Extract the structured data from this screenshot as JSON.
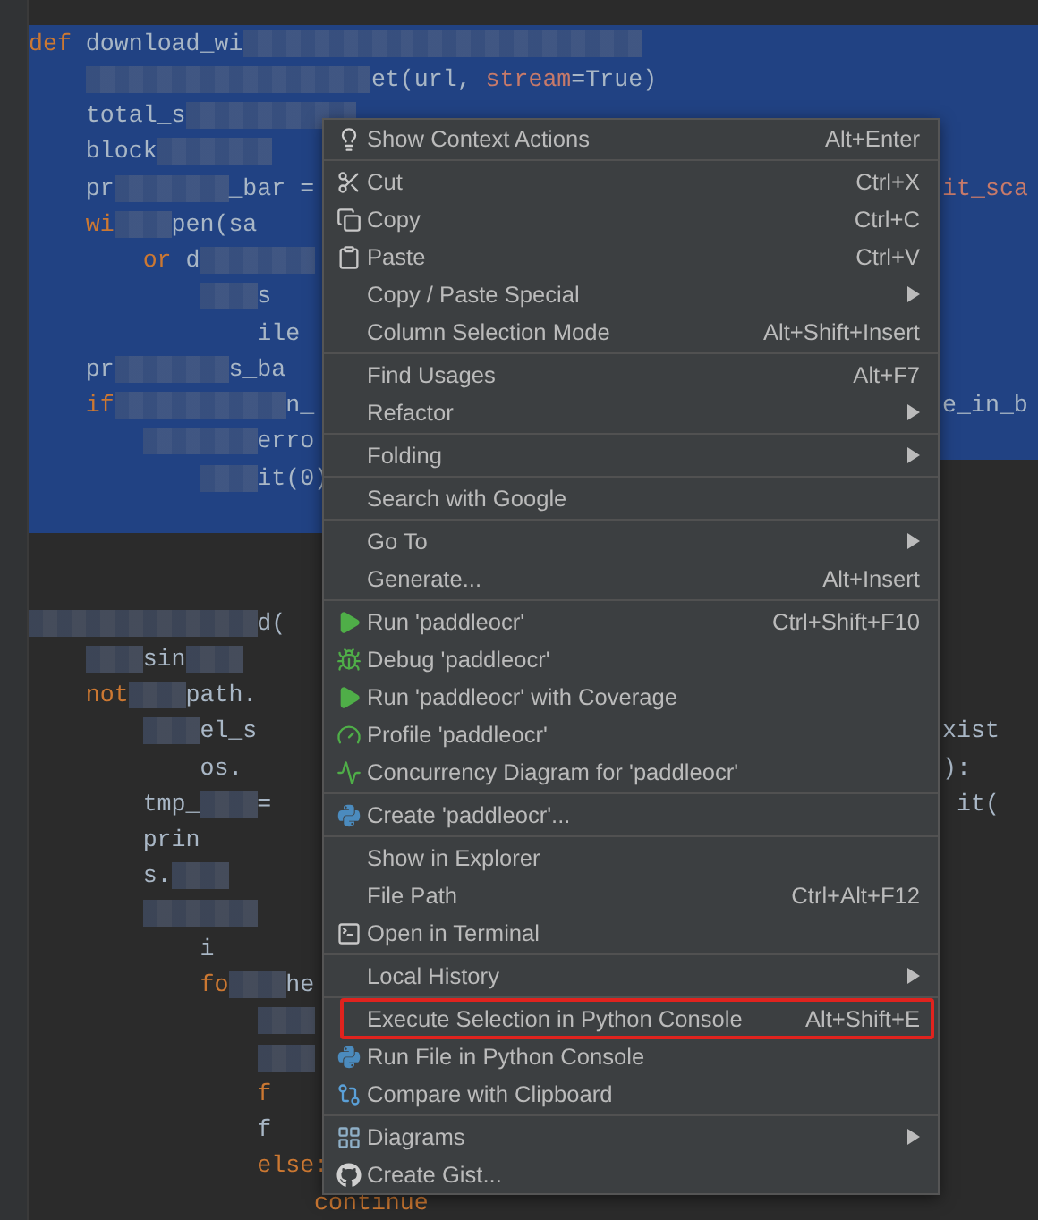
{
  "editor": {
    "lines": [
      {
        "selected": true,
        "full_width": true,
        "segments": [
          {
            "kind": "kw",
            "text": "def"
          },
          {
            "kind": "plain",
            "text": " download_wi"
          },
          {
            "kind": "redacted"
          },
          {
            "kind": "redacted"
          },
          {
            "kind": "redacted"
          },
          {
            "kind": "redacted"
          },
          {
            "kind": "redacted"
          },
          {
            "kind": "redacted"
          },
          {
            "kind": "redacted"
          }
        ]
      },
      {
        "selected": true,
        "full_width": true,
        "segments": [
          {
            "kind": "indent"
          },
          {
            "kind": "redacted"
          },
          {
            "kind": "redacted"
          },
          {
            "kind": "redacted"
          },
          {
            "kind": "redacted"
          },
          {
            "kind": "redacted"
          },
          {
            "kind": "plain",
            "text": "et(url, "
          },
          {
            "kind": "param",
            "text": "stream"
          },
          {
            "kind": "plain",
            "text": "=True)"
          }
        ]
      },
      {
        "selected": true,
        "full_width": true,
        "segments": [
          {
            "kind": "indent"
          },
          {
            "kind": "plain",
            "text": "total_s"
          },
          {
            "kind": "redacted"
          },
          {
            "kind": "redacted"
          },
          {
            "kind": "redacted"
          }
        ]
      },
      {
        "selected": true,
        "full_width": true,
        "segments": [
          {
            "kind": "indent"
          },
          {
            "kind": "plain",
            "text": "block"
          },
          {
            "kind": "redacted"
          },
          {
            "kind": "redacted"
          }
        ]
      },
      {
        "selected": true,
        "full_width": true,
        "segments": [
          {
            "kind": "indent"
          },
          {
            "kind": "plain",
            "text": "pr"
          },
          {
            "kind": "redacted"
          },
          {
            "kind": "redacted"
          },
          {
            "kind": "plain",
            "text": "_bar ="
          },
          {
            "kind": "indent"
          },
          {
            "kind": "indent"
          },
          {
            "kind": "indent"
          },
          {
            "kind": "indent"
          },
          {
            "kind": "indent"
          },
          {
            "kind": "indent"
          },
          {
            "kind": "indent"
          },
          {
            "kind": "indent"
          },
          {
            "kind": "indent"
          },
          {
            "kind": "indent"
          },
          {
            "kind": "indent"
          },
          {
            "kind": "param",
            "text": "it_sca"
          }
        ]
      },
      {
        "selected": true,
        "full_width": true,
        "segments": [
          {
            "kind": "indent"
          },
          {
            "kind": "kw",
            "text": "wi"
          },
          {
            "kind": "redacted"
          },
          {
            "kind": "plain",
            "text": "pen(sa"
          }
        ]
      },
      {
        "selected": true,
        "full_width": true,
        "segments": [
          {
            "kind": "indent"
          },
          {
            "kind": "indent"
          },
          {
            "kind": "kw",
            "text": "or"
          },
          {
            "kind": "plain",
            "text": " d"
          },
          {
            "kind": "redacted"
          },
          {
            "kind": "redacted"
          }
        ]
      },
      {
        "selected": true,
        "full_width": true,
        "segments": [
          {
            "kind": "indent"
          },
          {
            "kind": "indent"
          },
          {
            "kind": "indent"
          },
          {
            "kind": "redacted"
          },
          {
            "kind": "plain",
            "text": "s"
          }
        ]
      },
      {
        "selected": true,
        "full_width": true,
        "segments": [
          {
            "kind": "indent"
          },
          {
            "kind": "indent"
          },
          {
            "kind": "indent"
          },
          {
            "kind": "indent"
          },
          {
            "kind": "plain",
            "text": "ile"
          }
        ]
      },
      {
        "selected": true,
        "full_width": true,
        "segments": [
          {
            "kind": "indent"
          },
          {
            "kind": "plain",
            "text": "pr"
          },
          {
            "kind": "redacted"
          },
          {
            "kind": "redacted"
          },
          {
            "kind": "plain",
            "text": "s_ba"
          }
        ]
      },
      {
        "selected": true,
        "full_width": true,
        "segments": [
          {
            "kind": "indent"
          },
          {
            "kind": "kw",
            "text": "if"
          },
          {
            "kind": "redacted"
          },
          {
            "kind": "redacted"
          },
          {
            "kind": "redacted"
          },
          {
            "kind": "plain",
            "text": "n_"
          },
          {
            "kind": "indent"
          },
          {
            "kind": "indent"
          },
          {
            "kind": "indent"
          },
          {
            "kind": "indent"
          },
          {
            "kind": "indent"
          },
          {
            "kind": "indent"
          },
          {
            "kind": "indent"
          },
          {
            "kind": "indent"
          },
          {
            "kind": "indent"
          },
          {
            "kind": "indent"
          },
          {
            "kind": "indent"
          },
          {
            "kind": "plain",
            "text": "e_in_b"
          }
        ]
      },
      {
        "selected": true,
        "full_width": true,
        "segments": [
          {
            "kind": "indent"
          },
          {
            "kind": "indent"
          },
          {
            "kind": "redacted"
          },
          {
            "kind": "redacted"
          },
          {
            "kind": "plain",
            "text": "erro"
          }
        ]
      },
      {
        "selected": true,
        "full_width": false,
        "segments": [
          {
            "kind": "indent"
          },
          {
            "kind": "indent"
          },
          {
            "kind": "indent"
          },
          {
            "kind": "redacted"
          },
          {
            "kind": "plain",
            "text": "it(0)"
          }
        ]
      },
      {
        "selected": true,
        "full_width": false
      },
      {
        "selected": false
      },
      {
        "selected": false
      },
      {
        "selected": false,
        "segments": [
          {
            "kind": "redacted"
          },
          {
            "kind": "redacted"
          },
          {
            "kind": "redacted"
          },
          {
            "kind": "redacted"
          },
          {
            "kind": "plain",
            "text": "d("
          }
        ]
      },
      {
        "selected": false,
        "segments": [
          {
            "kind": "indent"
          },
          {
            "kind": "redacted"
          },
          {
            "kind": "plain",
            "text": "sin"
          },
          {
            "kind": "redacted"
          }
        ]
      },
      {
        "selected": false,
        "segments": [
          {
            "kind": "indent"
          },
          {
            "kind": "kw",
            "text": "not"
          },
          {
            "kind": "redacted"
          },
          {
            "kind": "plain",
            "text": "path."
          }
        ]
      },
      {
        "selected": false,
        "segments": [
          {
            "kind": "indent"
          },
          {
            "kind": "indent"
          },
          {
            "kind": "redacted"
          },
          {
            "kind": "plain",
            "text": "el_s"
          },
          {
            "kind": "indent"
          },
          {
            "kind": "indent"
          },
          {
            "kind": "indent"
          },
          {
            "kind": "indent"
          },
          {
            "kind": "indent"
          },
          {
            "kind": "indent"
          },
          {
            "kind": "indent"
          },
          {
            "kind": "indent"
          },
          {
            "kind": "indent"
          },
          {
            "kind": "indent"
          },
          {
            "kind": "indent"
          },
          {
            "kind": "indent"
          },
          {
            "kind": "plain",
            "text": "xist"
          }
        ]
      },
      {
        "selected": false,
        "segments": [
          {
            "kind": "indent"
          },
          {
            "kind": "indent"
          },
          {
            "kind": "indent"
          },
          {
            "kind": "plain",
            "text": "os."
          },
          {
            "kind": "indent"
          },
          {
            "kind": "indent"
          },
          {
            "kind": "indent"
          },
          {
            "kind": "indent"
          },
          {
            "kind": "indent"
          },
          {
            "kind": "indent"
          },
          {
            "kind": "indent"
          },
          {
            "kind": "indent"
          },
          {
            "kind": "indent"
          },
          {
            "kind": "indent"
          },
          {
            "kind": "indent"
          },
          {
            "kind": "indent"
          },
          {
            "kind": "plain",
            "text": " ):"
          }
        ]
      },
      {
        "selected": false,
        "segments": [
          {
            "kind": "indent"
          },
          {
            "kind": "indent"
          },
          {
            "kind": "plain",
            "text": "tmp_"
          },
          {
            "kind": "redacted"
          },
          {
            "kind": "plain",
            "text": "="
          },
          {
            "kind": "indent"
          },
          {
            "kind": "indent"
          },
          {
            "kind": "indent"
          },
          {
            "kind": "indent"
          },
          {
            "kind": "indent"
          },
          {
            "kind": "indent"
          },
          {
            "kind": "indent"
          },
          {
            "kind": "indent"
          },
          {
            "kind": "indent"
          },
          {
            "kind": "indent"
          },
          {
            "kind": "indent"
          },
          {
            "kind": "indent"
          },
          {
            "kind": "plain",
            "text": "it("
          }
        ]
      },
      {
        "selected": false,
        "segments": [
          {
            "kind": "indent"
          },
          {
            "kind": "indent"
          },
          {
            "kind": "plain",
            "text": "prin"
          }
        ]
      },
      {
        "selected": false,
        "segments": [
          {
            "kind": "indent"
          },
          {
            "kind": "indent"
          },
          {
            "kind": "plain",
            "text": "s."
          },
          {
            "kind": "redacted"
          }
        ]
      },
      {
        "selected": false,
        "segments": [
          {
            "kind": "indent"
          },
          {
            "kind": "indent"
          },
          {
            "kind": "redacted"
          },
          {
            "kind": "redacted"
          }
        ]
      },
      {
        "selected": false,
        "segments": [
          {
            "kind": "indent"
          },
          {
            "kind": "indent"
          },
          {
            "kind": "indent"
          },
          {
            "kind": "plain",
            "text": "i"
          }
        ]
      },
      {
        "selected": false,
        "segments": [
          {
            "kind": "indent"
          },
          {
            "kind": "indent"
          },
          {
            "kind": "indent"
          },
          {
            "kind": "kw",
            "text": "fo"
          },
          {
            "kind": "redacted"
          },
          {
            "kind": "plain",
            "text": "he"
          }
        ]
      },
      {
        "selected": false,
        "segments": [
          {
            "kind": "indent"
          },
          {
            "kind": "indent"
          },
          {
            "kind": "indent"
          },
          {
            "kind": "indent"
          },
          {
            "kind": "redacted"
          }
        ]
      },
      {
        "selected": false,
        "segments": [
          {
            "kind": "indent"
          },
          {
            "kind": "indent"
          },
          {
            "kind": "indent"
          },
          {
            "kind": "indent"
          },
          {
            "kind": "redacted"
          }
        ]
      },
      {
        "selected": false,
        "segments": [
          {
            "kind": "indent"
          },
          {
            "kind": "indent"
          },
          {
            "kind": "indent"
          },
          {
            "kind": "indent"
          },
          {
            "kind": "kw",
            "text": "f"
          }
        ]
      },
      {
        "selected": false,
        "segments": [
          {
            "kind": "indent"
          },
          {
            "kind": "indent"
          },
          {
            "kind": "indent"
          },
          {
            "kind": "indent"
          },
          {
            "kind": "plain",
            "text": "f"
          }
        ]
      },
      {
        "selected": false,
        "segments": [
          {
            "kind": "indent"
          },
          {
            "kind": "indent"
          },
          {
            "kind": "indent"
          },
          {
            "kind": "indent"
          },
          {
            "kind": "kw",
            "text": "else:"
          }
        ]
      },
      {
        "selected": false,
        "segments": [
          {
            "kind": "indent"
          },
          {
            "kind": "indent"
          },
          {
            "kind": "indent"
          },
          {
            "kind": "indent"
          },
          {
            "kind": "indent"
          },
          {
            "kind": "kw",
            "text": "continue"
          }
        ]
      }
    ]
  },
  "context_menu": {
    "groups": [
      [
        {
          "label": "Show Context Actions",
          "shortcut": "Alt+Enter",
          "has_submenu": false,
          "annotated": false
        }
      ],
      [
        {
          "label": "Cut",
          "shortcut": "Ctrl+X",
          "has_submenu": false,
          "annotated": false
        },
        {
          "label": "Copy",
          "shortcut": "Ctrl+C",
          "has_submenu": false,
          "annotated": false
        },
        {
          "label": "Paste",
          "shortcut": "Ctrl+V",
          "has_submenu": false,
          "annotated": false
        },
        {
          "label": "Copy / Paste Special",
          "has_submenu": true,
          "annotated": false
        },
        {
          "label": "Column Selection Mode",
          "shortcut": "Alt+Shift+Insert",
          "has_submenu": false,
          "annotated": false
        }
      ],
      [
        {
          "label": "Find Usages",
          "shortcut": "Alt+F7",
          "has_submenu": false,
          "annotated": false
        },
        {
          "label": "Refactor",
          "has_submenu": true,
          "annotated": false
        }
      ],
      [
        {
          "label": "Folding",
          "has_submenu": true,
          "annotated": false
        }
      ],
      [
        {
          "label": "Search with Google",
          "has_submenu": false,
          "annotated": false
        }
      ],
      [
        {
          "label": "Go To",
          "has_submenu": true,
          "annotated": false
        },
        {
          "label": "Generate...",
          "shortcut": "Alt+Insert",
          "has_submenu": false,
          "annotated": false
        }
      ],
      [
        {
          "label": "Run 'paddleocr'",
          "shortcut": "Ctrl+Shift+F10",
          "has_submenu": false,
          "annotated": false
        },
        {
          "label": "Debug 'paddleocr'",
          "has_submenu": false,
          "annotated": false
        },
        {
          "label": "Run 'paddleocr' with Coverage",
          "has_submenu": false,
          "annotated": false
        },
        {
          "label": "Profile 'paddleocr'",
          "has_submenu": false,
          "annotated": false
        },
        {
          "label": "Concurrency Diagram for 'paddleocr'",
          "has_submenu": false,
          "annotated": false
        }
      ],
      [
        {
          "label": "Create 'paddleocr'...",
          "has_submenu": false,
          "annotated": false
        }
      ],
      [
        {
          "label": "Show in Explorer",
          "has_submenu": false,
          "annotated": false
        },
        {
          "label": "File Path",
          "shortcut": "Ctrl+Alt+F12",
          "has_submenu": false,
          "annotated": false
        },
        {
          "label": "Open in Terminal",
          "has_submenu": false,
          "annotated": false
        }
      ],
      [
        {
          "label": "Local History",
          "has_submenu": true,
          "annotated": false
        }
      ],
      [
        {
          "label": "Execute Selection in Python Console",
          "shortcut": "Alt+Shift+E",
          "has_submenu": false,
          "annotated": true
        },
        {
          "label": "Run File in Python Console",
          "has_submenu": false,
          "annotated": false
        },
        {
          "label": "Compare with Clipboard",
          "has_submenu": false,
          "annotated": false
        }
      ],
      [
        {
          "label": "Diagrams",
          "has_submenu": true,
          "annotated": false
        },
        {
          "label": "Create Gist...",
          "has_submenu": false,
          "annotated": false
        }
      ]
    ]
  }
}
